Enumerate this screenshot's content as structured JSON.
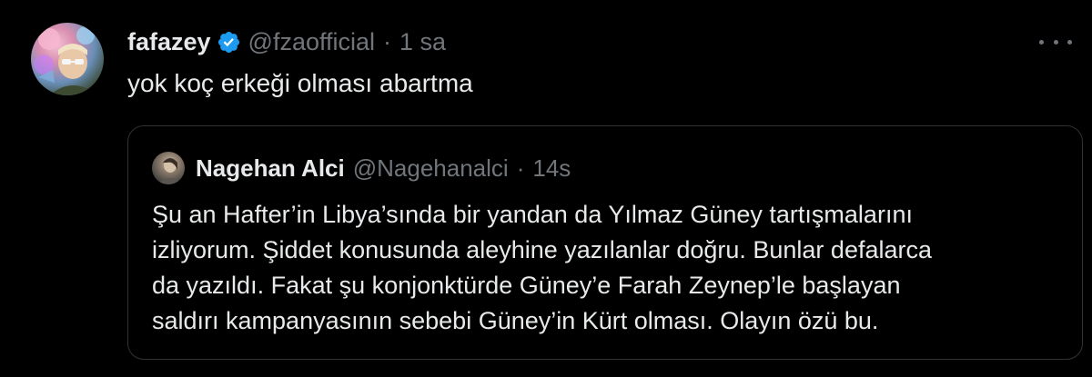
{
  "tweet": {
    "display_name": "fafazey",
    "handle": "@fzaofficial",
    "separator": "·",
    "time": "1 sa",
    "text": "yok koç erkeği olması abartma",
    "avatar_icon": "user-avatar",
    "verified_icon": "verified-badge-icon",
    "more_icon": "more-options-icon"
  },
  "quote": {
    "display_name": "Nagehan Alci",
    "handle": "@Nagehanalci",
    "separator": "·",
    "time": "14s",
    "lines": [
      "Şu an Hafter’in Libya’sında bir yandan da Yılmaz Güney tartışmalarını",
      "izliyorum. Şiddet konusunda aleyhine yazılanlar doğru. Bunlar defalarca",
      "da yazıldı. Fakat şu konjonktürde Güney’e Farah Zeynep’le başlayan",
      "saldırı kampanyasının sebebi Güney’in Kürt olması. Olayın özü bu."
    ]
  },
  "colors": {
    "background": "#000000",
    "text_primary": "#e7e9ea",
    "text_secondary": "#71767b",
    "border": "#2f3336",
    "verified_blue": "#1d9bf0"
  }
}
